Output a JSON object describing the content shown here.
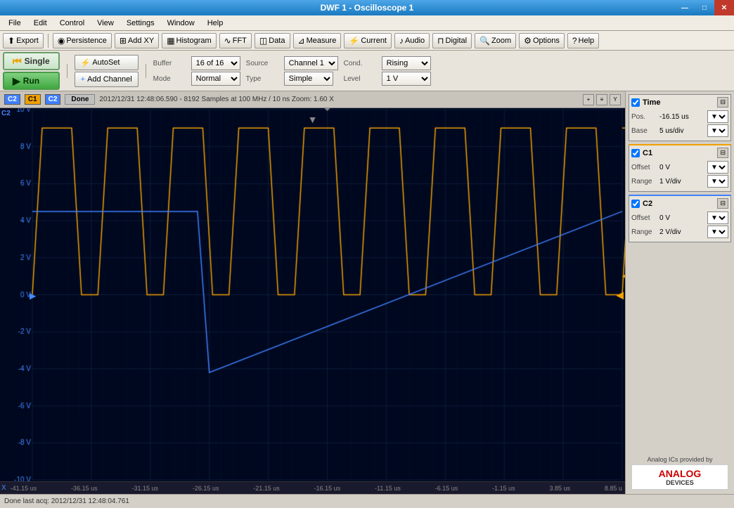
{
  "window": {
    "title": "DWF 1 - Oscilloscope 1",
    "min_label": "—",
    "max_label": "□",
    "close_label": "✕"
  },
  "menubar": {
    "items": [
      "File",
      "Edit",
      "Control",
      "View",
      "Settings",
      "Window",
      "Help"
    ]
  },
  "toolbar": {
    "items": [
      {
        "label": "Export",
        "icon": "⬆"
      },
      {
        "label": "Persistence",
        "icon": "◉"
      },
      {
        "label": "Add XY",
        "icon": "⊞"
      },
      {
        "label": "Histogram",
        "icon": "▦"
      },
      {
        "label": "FFT",
        "icon": "∿"
      },
      {
        "label": "Data",
        "icon": "◫"
      },
      {
        "label": "Measure",
        "icon": "⊿"
      },
      {
        "label": "Current",
        "icon": "⚡"
      },
      {
        "label": "Audio",
        "icon": "♪"
      },
      {
        "label": "Digital",
        "icon": "⊓"
      },
      {
        "label": "Zoom",
        "icon": "🔍"
      },
      {
        "label": "Options",
        "icon": "⚙"
      },
      {
        "label": "Help",
        "icon": "?"
      }
    ]
  },
  "controls": {
    "single_label": "Single",
    "run_label": "Run",
    "autoset_label": "AutoSet",
    "add_channel_label": "Add Channel",
    "buffer_label": "Buffer",
    "buffer_value": "16 of 16",
    "mode_label": "Mode",
    "mode_value": "Normal",
    "source_label": "Source",
    "source_value": "Channel 1",
    "type_label": "Type",
    "type_value": "Simple",
    "cond_label": "Cond.",
    "cond_value": "Rising",
    "level_label": "Level",
    "level_value": "1 V"
  },
  "scope": {
    "ch1_label": "C1",
    "ch2_label": "C2",
    "done_label": "Done",
    "info_text": "2012/12/31  12:48:06.590 - 8192 Samples at 100 MHz / 10 ns  Zoom: 1.60 X",
    "y_labels": [
      "10 V",
      "8 V",
      "6 V",
      "4 V",
      "2 V",
      "0 V",
      "-2 V",
      "-4 V",
      "-6 V",
      "-8 V",
      "-10 V"
    ],
    "x_labels": [
      "-41.15 us",
      "-36.15 us",
      "-31.15 us",
      "-26.15 us",
      "-21.15 us",
      "-16.15 us",
      "-11.15 us",
      "-6.15 us",
      "-1.15 us",
      "3.85 us",
      "8.85 u"
    ],
    "ch2_marker": "C2",
    "x_axis_label": "X"
  },
  "right_panel": {
    "time_section": {
      "title": "Time",
      "pos_label": "Pos.",
      "pos_value": "-16.15 us",
      "base_label": "Base",
      "base_value": "5 us/div"
    },
    "c1_section": {
      "title": "C1",
      "offset_label": "Offset",
      "offset_value": "0 V",
      "range_label": "Range",
      "range_value": "1 V/div"
    },
    "c2_section": {
      "title": "C2",
      "offset_label": "Offset",
      "offset_value": "0 V",
      "range_label": "Range",
      "range_value": "2 V/div"
    }
  },
  "analog_devices": {
    "tagline": "Analog ICs provided by",
    "brand": "ANALOG",
    "subtitle": "DEVICES"
  },
  "statusbar": {
    "text": "Done last acq: 2012/12/31  12:48:04.761"
  }
}
